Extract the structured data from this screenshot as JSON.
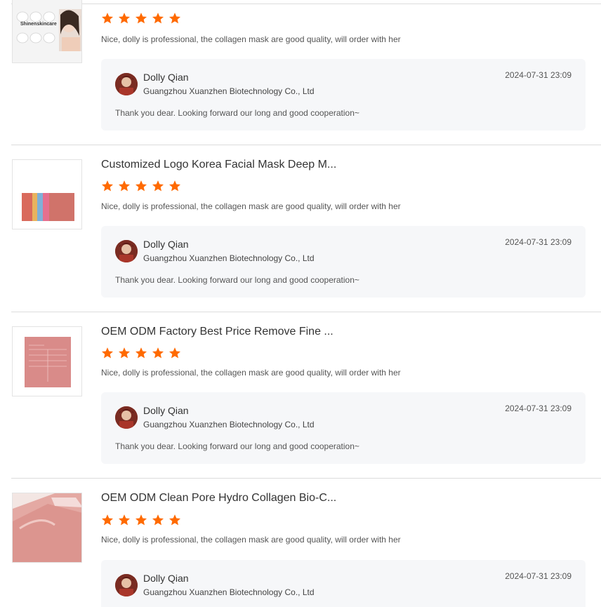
{
  "reviews": [
    {
      "product_title": "",
      "thumb_caption": "Shinenskincare",
      "rating": 5,
      "comment": "Nice, dolly is professional, the collagen mask are good quality, will order with her",
      "reply": {
        "name": "Dolly Qian",
        "company": "Guangzhou Xuanzhen Biotechnology Co., Ltd",
        "date": "2024-07-31 23:09",
        "text": "Thank you dear. Looking forward our long and good cooperation~"
      }
    },
    {
      "product_title": "Customized Logo Korea Facial Mask Deep M...",
      "rating": 5,
      "comment": "Nice, dolly is professional, the collagen mask are good quality, will order with her",
      "reply": {
        "name": "Dolly Qian",
        "company": "Guangzhou Xuanzhen Biotechnology Co., Ltd",
        "date": "2024-07-31 23:09",
        "text": "Thank you dear. Looking forward our long and good cooperation~"
      }
    },
    {
      "product_title": "OEM ODM Factory Best Price Remove Fine ...",
      "rating": 5,
      "comment": "Nice, dolly is professional, the collagen mask are good quality, will order with her",
      "reply": {
        "name": "Dolly Qian",
        "company": "Guangzhou Xuanzhen Biotechnology Co., Ltd",
        "date": "2024-07-31 23:09",
        "text": "Thank you dear. Looking forward our long and good cooperation~"
      }
    },
    {
      "product_title": "OEM ODM Clean Pore Hydro Collagen Bio-C...",
      "rating": 5,
      "comment": "Nice, dolly is professional, the collagen mask are good quality, will order with her",
      "reply": {
        "name": "Dolly Qian",
        "company": "Guangzhou Xuanzhen Biotechnology Co., Ltd",
        "date": "2024-07-31 23:09",
        "text": ""
      }
    }
  ],
  "colors": {
    "star": "#ff6a00",
    "reply_bg": "#f6f7f9",
    "divider": "#dcdcdc"
  },
  "icons": {
    "star": "star-icon",
    "avatar": "avatar"
  }
}
